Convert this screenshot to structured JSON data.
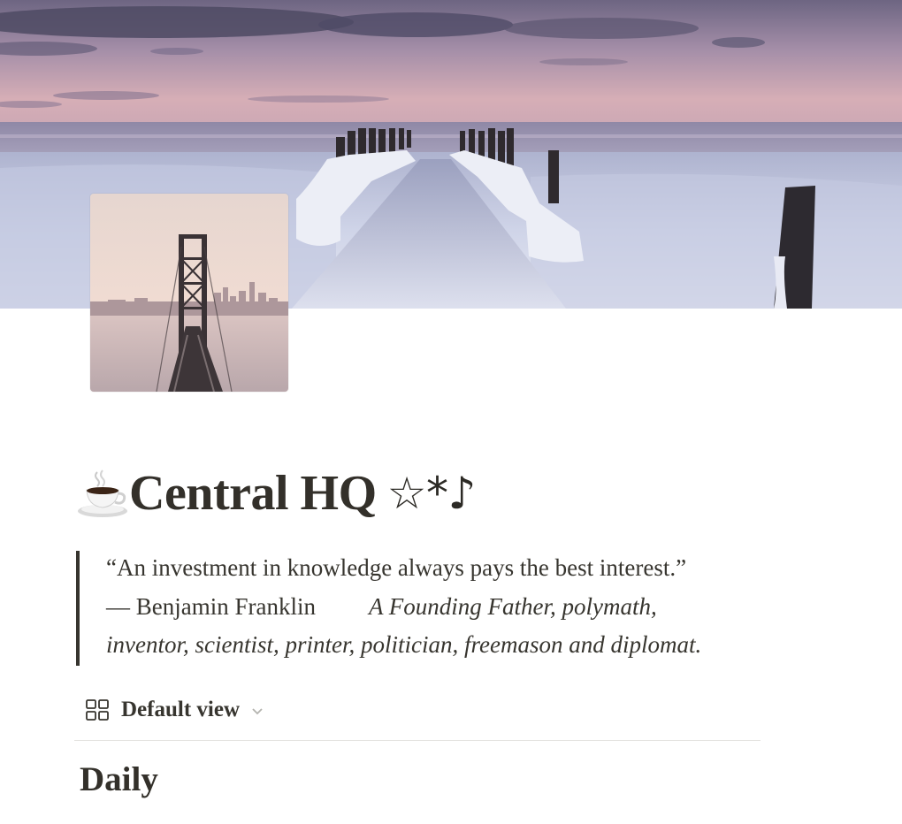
{
  "page": {
    "title": "Central HQ",
    "title_emoji": "coffee-cup-icon",
    "title_suffix": "☆*♪",
    "cover": "frozen-pier-sunset-cover",
    "icon": "bay-bridge-skyline-image"
  },
  "quote": {
    "text": "“An investment in knowledge always pays the best interest.”",
    "author": "— Benjamin Franklin",
    "description_part1": "A Founding Father, polymath,",
    "description_part2": "inventor, scientist, printer, politician, freemason and diplomat."
  },
  "view": {
    "label": "Default view",
    "icon": "gallery-grid-icon"
  },
  "section": {
    "heading": "Daily"
  },
  "colors": {
    "text": "#37352f",
    "divider": "#e3e2df",
    "sky_top": "#7c6f8e",
    "sky_bottom": "#cfa9b4",
    "snow": "#dfe3f0"
  }
}
